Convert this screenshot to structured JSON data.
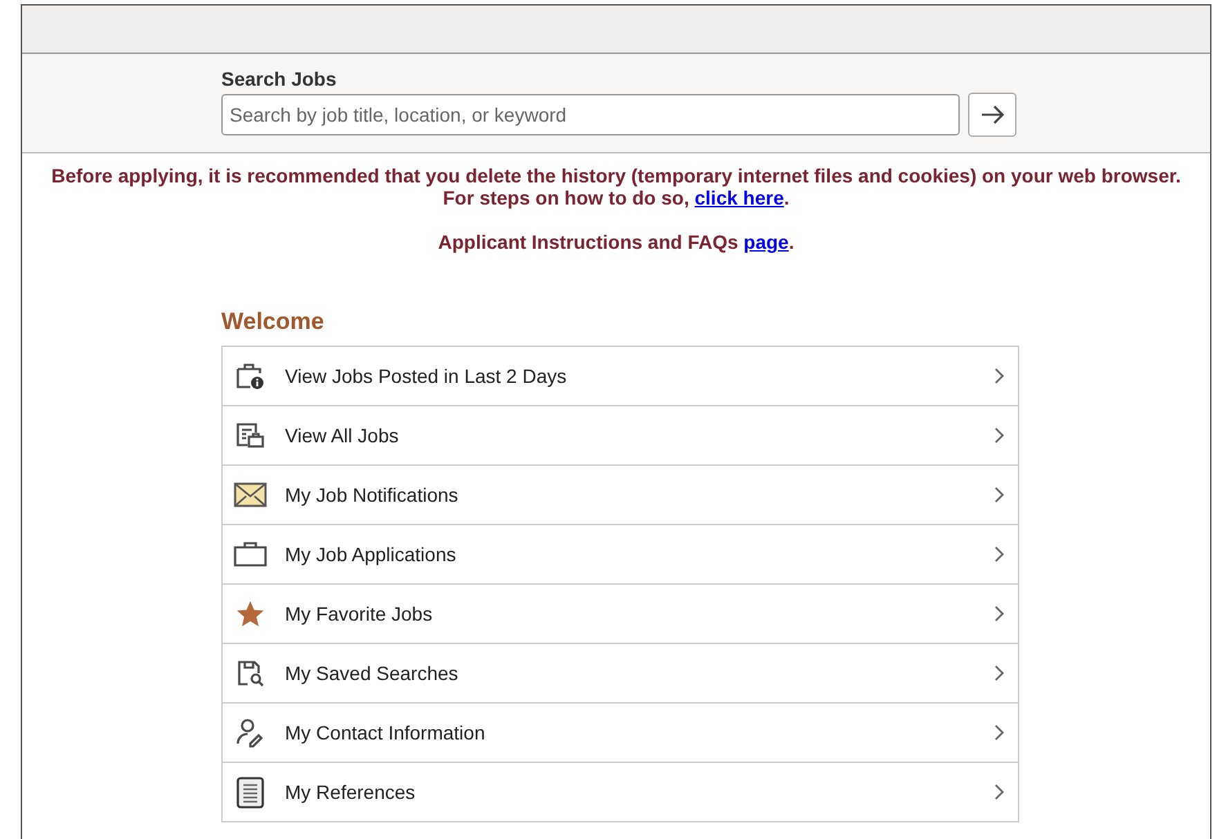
{
  "search": {
    "label": "Search Jobs",
    "placeholder": "Search by job title, location, or keyword"
  },
  "notice": {
    "line1": "Before applying, it is recommended that you delete the history (temporary internet files and cookies) on your web browser.",
    "line2": "For steps on how to do so,",
    "link": "click here",
    "line2_end": ".",
    "line3": "Applicant Instructions and FAQs",
    "line3_link": "page",
    "line3_end": "."
  },
  "welcome": "Welcome",
  "items": [
    {
      "kind": "recent",
      "label": "View Jobs Posted in Last 2 Days"
    },
    {
      "kind": "all",
      "label": "View All Jobs"
    },
    {
      "kind": "mail",
      "label": "My Job Notifications"
    },
    {
      "kind": "briefcase",
      "label": "My Job Applications"
    },
    {
      "kind": "star",
      "label": "My Favorite Jobs"
    },
    {
      "kind": "saved",
      "label": "My Saved Searches"
    },
    {
      "kind": "contact",
      "label": "My Contact Information"
    },
    {
      "kind": "notepad",
      "label": "My References"
    }
  ]
}
